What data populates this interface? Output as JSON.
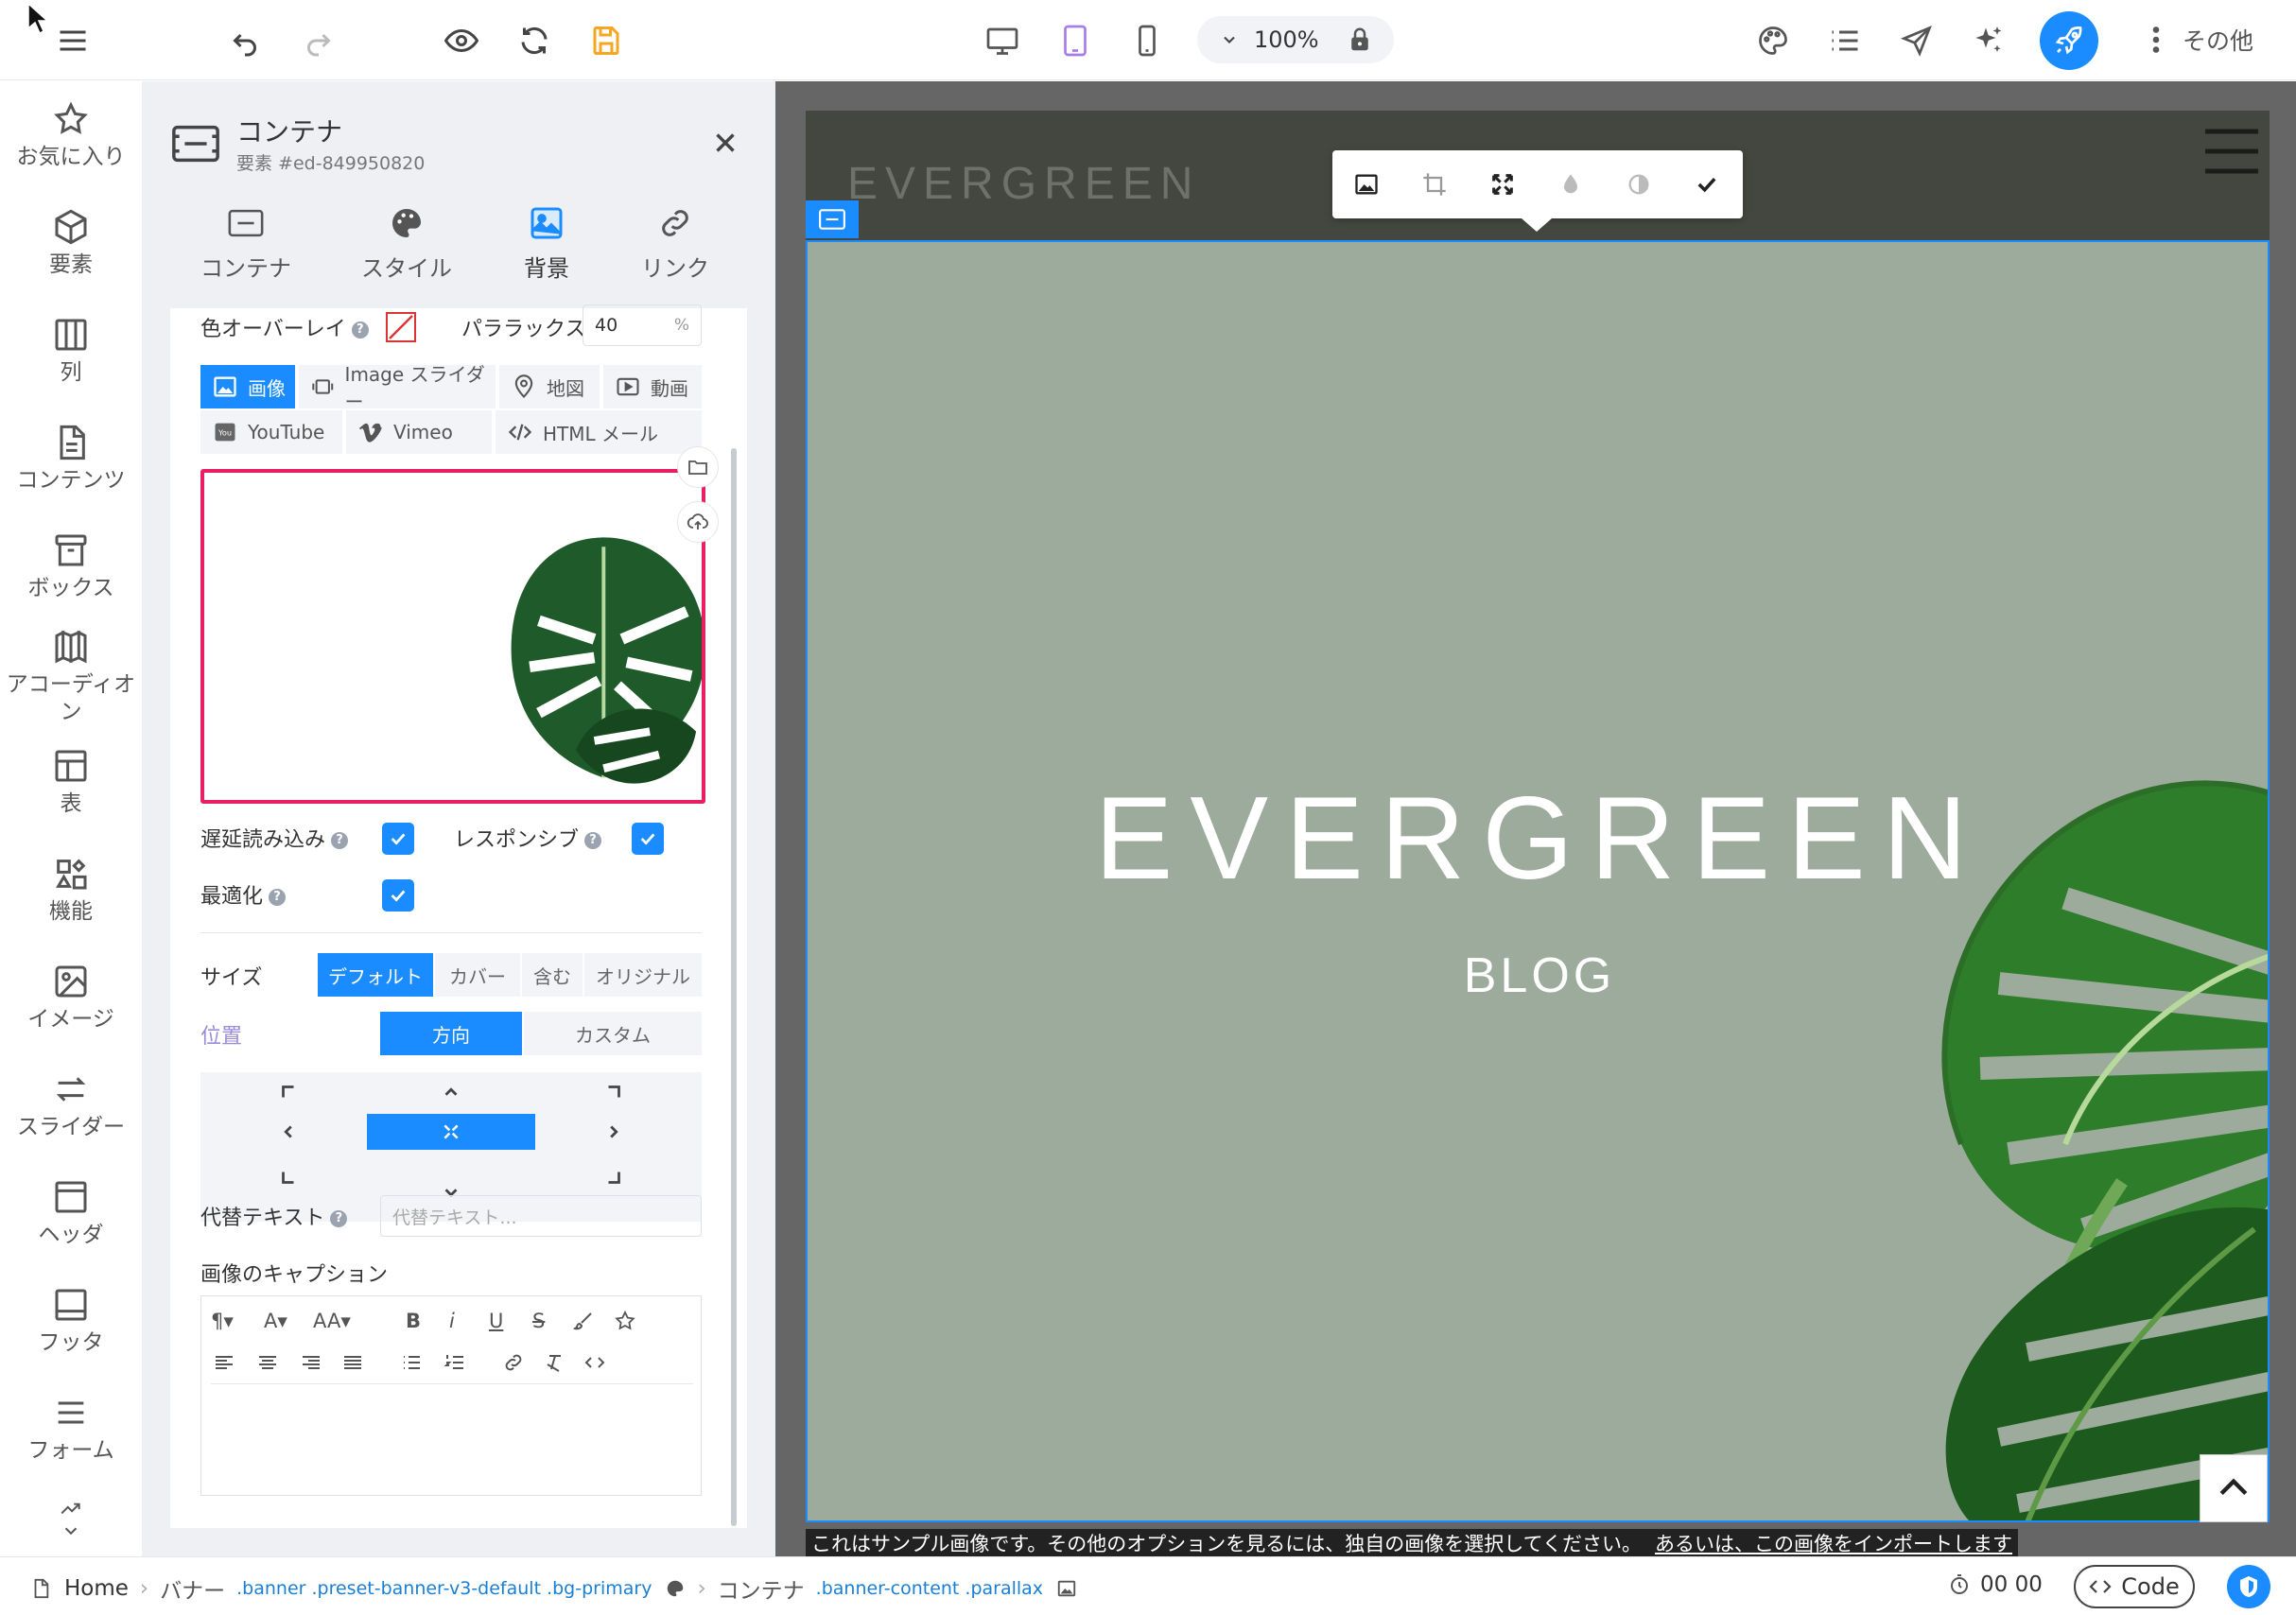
{
  "toolbar": {
    "zoom": "100%",
    "more_label": "その他",
    "colors": {
      "accent": "#1a8cff",
      "save": "#f5a623",
      "tablet_active": "#a87ce8"
    }
  },
  "sidebar": {
    "items": [
      {
        "label": "お気に入り",
        "icon": "star-icon"
      },
      {
        "label": "要素",
        "icon": "cube-icon"
      },
      {
        "label": "列",
        "icon": "columns-icon"
      },
      {
        "label": "コンテンツ",
        "icon": "document-icon"
      },
      {
        "label": "ボックス",
        "icon": "box-icon"
      },
      {
        "label": "アコーディオン",
        "icon": "accordion-icon"
      },
      {
        "label": "表",
        "icon": "table-icon"
      },
      {
        "label": "機能",
        "icon": "features-icon"
      },
      {
        "label": "イメージ",
        "icon": "image-icon"
      },
      {
        "label": "スライダー",
        "icon": "slider-icon"
      },
      {
        "label": "ヘッダ",
        "icon": "header-icon"
      },
      {
        "label": "フッタ",
        "icon": "footer-icon"
      },
      {
        "label": "フォーム",
        "icon": "form-icon"
      }
    ]
  },
  "panel": {
    "title": "コンテナ",
    "subtitle": "要素 #ed-849950820",
    "tabs": [
      {
        "label": "コンテナ",
        "icon": "container-icon"
      },
      {
        "label": "スタイル",
        "icon": "palette-icon"
      },
      {
        "label": "背景",
        "icon": "image-icon",
        "active": true
      },
      {
        "label": "リンク",
        "icon": "link-icon"
      }
    ],
    "overlay_label": "色オーバーレイ",
    "parallax_label": "パララックス",
    "parallax_value": "40",
    "parallax_unit": "%",
    "sources": [
      {
        "label": "画像",
        "active": true
      },
      {
        "label": "Image スライダー"
      },
      {
        "label": "地図"
      },
      {
        "label": "動画"
      },
      {
        "label": "YouTube"
      },
      {
        "label": "Vimeo"
      },
      {
        "label": "HTML メール"
      }
    ],
    "lazy_label": "遅延読み込み",
    "responsive_label": "レスポンシブ",
    "optimize_label": "最適化",
    "size_label": "サイズ",
    "size_options": [
      {
        "label": "デフォルト",
        "active": true
      },
      {
        "label": "カバー"
      },
      {
        "label": "含む"
      },
      {
        "label": "オリジナル"
      }
    ],
    "position_label": "位置",
    "position_options": [
      {
        "label": "方向",
        "active": true
      },
      {
        "label": "カスタム"
      }
    ],
    "alt_label": "代替テキスト",
    "alt_placeholder": "代替テキスト...",
    "caption_label": "画像のキャプション"
  },
  "canvas": {
    "header_logo": "EVERGREEN",
    "hero_title": "EVERGREEN",
    "hero_subtitle": "BLOG",
    "notice_text": "これはサンプル画像です。その他のオプションを見るには、独自の画像を選択してください。",
    "notice_link": "あるいは、この画像をインポートします",
    "banner_color": "#9cab9b"
  },
  "status": {
    "home": "Home",
    "crumb1": "バナー",
    "crumb1_classes": ".banner .preset-banner-v3-default .bg-primary",
    "crumb2": "コンテナ",
    "crumb2_classes": ".banner-content .parallax",
    "timer": "00 00",
    "code_label": "Code"
  }
}
